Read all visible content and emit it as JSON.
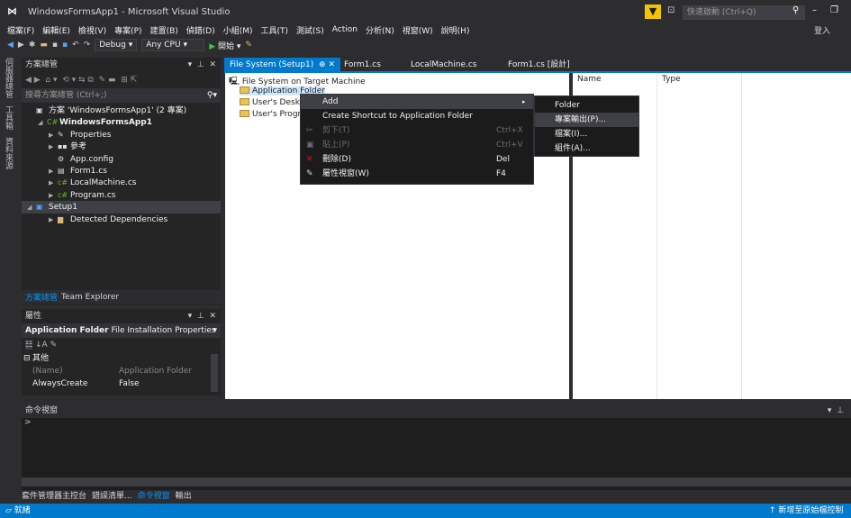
{
  "titlebar": {
    "title": "WindowsFormsApp1 - Microsoft Visual Studio",
    "quick_launch_placeholder": "快速啟動 (Ctrl+Q)",
    "sign_in": "登入"
  },
  "menubar": {
    "items": [
      "檔案(F)",
      "編輯(E)",
      "檢視(V)",
      "專案(P)",
      "建置(B)",
      "偵錯(D)",
      "小組(M)",
      "工具(T)",
      "測試(S)",
      "Action",
      "分析(N)",
      "視窗(W)",
      "說明(H)"
    ]
  },
  "toolbar": {
    "config": "Debug",
    "platform": "Any CPU",
    "start_label": "開始"
  },
  "left_tabs": [
    "伺服器總管",
    "工具箱",
    "資料來源"
  ],
  "solution_explorer": {
    "title": "方案總管",
    "search_placeholder": "搜尋方案總管 (Ctrl+;)",
    "items": [
      {
        "label": "方案 'WindowsFormsApp1' (2 專案)",
        "indent": 0,
        "arrow": "",
        "icon": "solution-icon"
      },
      {
        "label": "WindowsFormsApp1",
        "indent": 1,
        "arrow": "◢",
        "icon": "csharp-project-icon"
      },
      {
        "label": "Properties",
        "indent": 2,
        "arrow": "▶",
        "icon": "wrench-icon"
      },
      {
        "label": "參考",
        "indent": 2,
        "arrow": "▶",
        "icon": "references-icon"
      },
      {
        "label": "App.config",
        "indent": 2,
        "arrow": "",
        "icon": "config-icon"
      },
      {
        "label": "Form1.cs",
        "indent": 2,
        "arrow": "▶",
        "icon": "form-icon"
      },
      {
        "label": "LocalMachine.cs",
        "indent": 2,
        "arrow": "▶",
        "icon": "cs-file-icon"
      },
      {
        "label": "Program.cs",
        "indent": 2,
        "arrow": "▶",
        "icon": "cs-file-icon"
      },
      {
        "label": "Setup1",
        "indent": 0,
        "arrow": "◢",
        "icon": "setup-project-icon"
      },
      {
        "label": "Detected Dependencies",
        "indent": 2,
        "arrow": "▶",
        "icon": "folder-icon"
      }
    ],
    "footer_tabs": [
      "方案總管",
      "Team Explorer"
    ]
  },
  "properties": {
    "title": "屬性",
    "object_name": "Application Folder",
    "object_type": "File Installation Properties",
    "category": "其他",
    "rows": [
      {
        "name": "(Name)",
        "value": "Application Folder"
      },
      {
        "name": "AlwaysCreate",
        "value": "False"
      }
    ]
  },
  "doc_tabs": [
    {
      "label": "File System (Setup1)",
      "active": true
    },
    {
      "label": "Form1.cs",
      "active": false
    },
    {
      "label": "LocalMachine.cs",
      "active": false
    },
    {
      "label": "Form1.cs [設計]",
      "active": false
    }
  ],
  "filesystem": {
    "root": "File System on Target Machine",
    "folders": [
      "Application Folder",
      "User's Deskt",
      "User's Progra"
    ],
    "columns": [
      "Name",
      "Type"
    ]
  },
  "context_menu": {
    "items": [
      {
        "label": "Add",
        "shortcut": "",
        "disabled": false,
        "highlight": true,
        "submenu": true
      },
      {
        "label": "Create Shortcut to Application Folder",
        "shortcut": "",
        "disabled": false,
        "highlight": false,
        "submenu": false
      },
      {
        "label": "剪下(T)",
        "shortcut": "Ctrl+X",
        "disabled": true,
        "highlight": false,
        "submenu": false
      },
      {
        "label": "貼上(P)",
        "shortcut": "Ctrl+V",
        "disabled": true,
        "highlight": false,
        "submenu": false
      },
      {
        "label": "刪除(D)",
        "shortcut": "Del",
        "disabled": false,
        "highlight": false,
        "submenu": false
      },
      {
        "label": "屬性視窗(W)",
        "shortcut": "F4",
        "disabled": false,
        "highlight": false,
        "submenu": false
      }
    ],
    "submenu": [
      "Folder",
      "專案輸出(P)...",
      "檔案(I)...",
      "組件(A)..."
    ]
  },
  "command_window": {
    "title": "命令視窗",
    "prompt": ">"
  },
  "bottom_tabs": [
    "套件管理器主控台",
    "錯誤清單...",
    "命令視窗",
    "輸出"
  ],
  "statusbar": {
    "left": "就緒",
    "right": "新增至原始檔控制"
  },
  "colors": {
    "accent": "#007acc",
    "background": "#2d2d30",
    "panel": "#252526"
  }
}
